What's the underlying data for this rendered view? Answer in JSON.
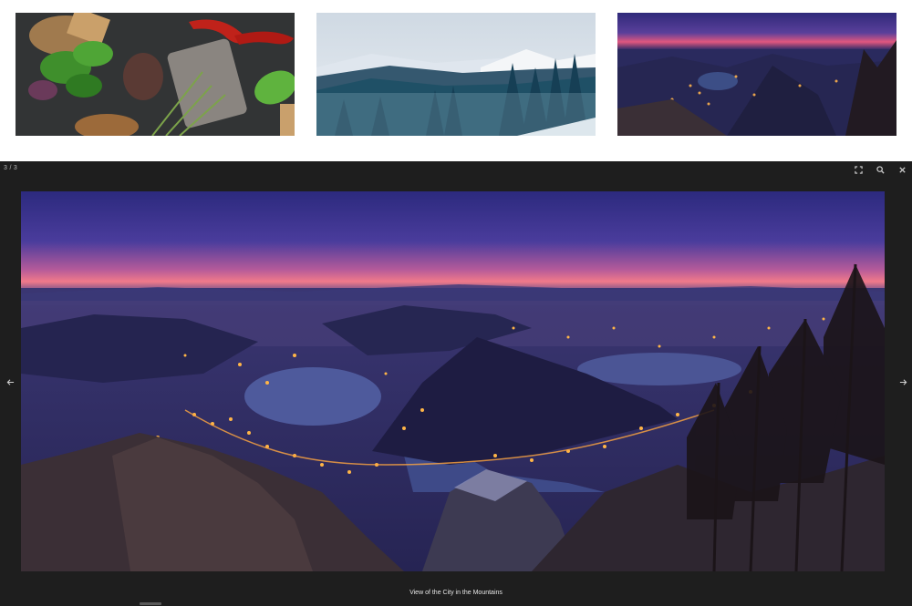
{
  "gallery": {
    "thumbnails": [
      {
        "subject": "herbs-and-spices"
      },
      {
        "subject": "snowy-forest-mountains"
      },
      {
        "subject": "city-in-mountains-at-dusk"
      }
    ]
  },
  "lightbox": {
    "counter": "3 / 3",
    "caption": "View of the City in the Mountains",
    "toolbar": {
      "icons": [
        "fullscreen-icon",
        "zoom-icon",
        "close-icon"
      ]
    },
    "navigation": {
      "prev_icon": "arrow-left-icon",
      "next_icon": "arrow-right-icon"
    }
  },
  "colors": {
    "overlay": "#1e1e1e",
    "icon": "#d0d0d0"
  }
}
